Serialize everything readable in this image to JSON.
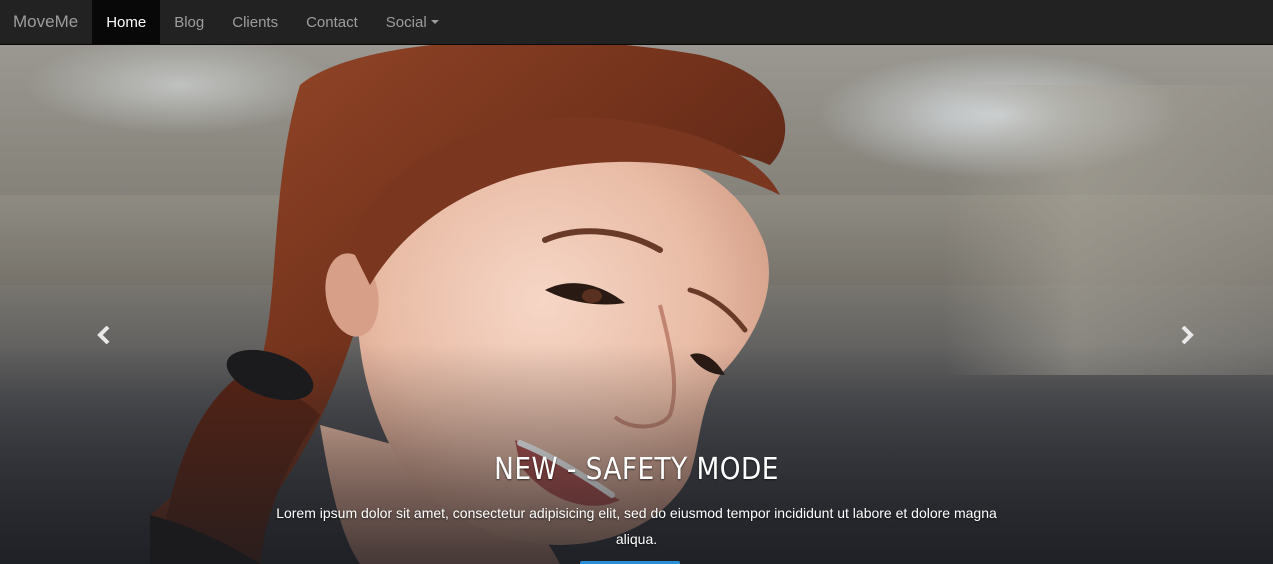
{
  "navbar": {
    "brand": "MoveMe",
    "items": [
      {
        "label": "Home",
        "active": true
      },
      {
        "label": "Blog",
        "active": false
      },
      {
        "label": "Clients",
        "active": false
      },
      {
        "label": "Contact",
        "active": false
      },
      {
        "label": "Social",
        "active": false,
        "dropdown": true
      }
    ]
  },
  "carousel": {
    "prev_icon": "chevron-left-icon",
    "next_icon": "chevron-right-icon",
    "caption": {
      "title": "NEW - SAFETY MODE",
      "text": "Lorem ipsum dolor sit amet, consectetur adipisicing elit, sed do eiusmod tempor incididunt ut labore et dolore magna aliqua."
    }
  },
  "colors": {
    "navbar_bg": "#222222",
    "nav_active_bg": "#080808",
    "nav_text": "#9d9d9d",
    "accent": "#2a8fd6"
  }
}
